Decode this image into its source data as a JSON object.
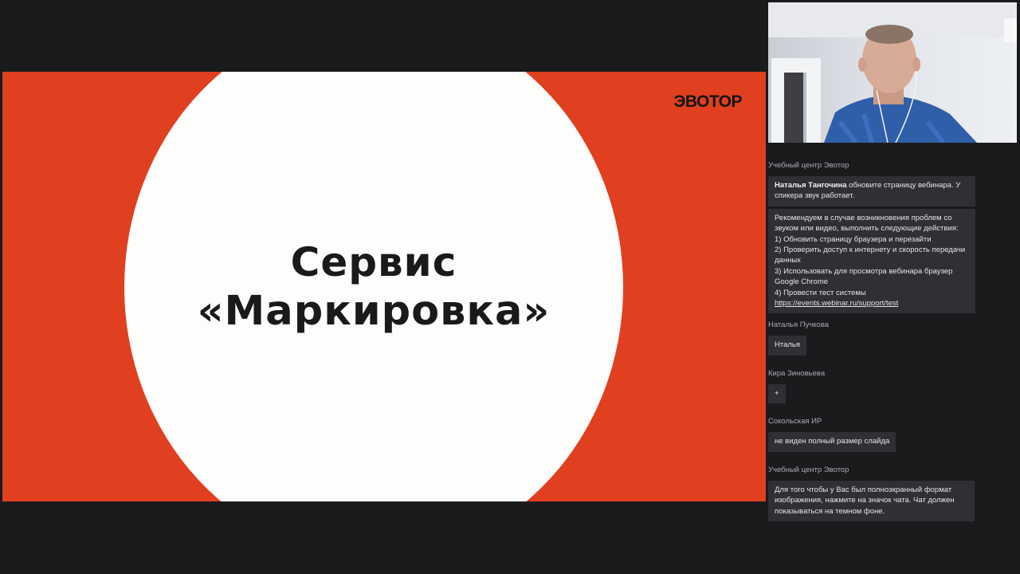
{
  "slide": {
    "logo": "ЭВОТОР",
    "title_line1": "Сервис",
    "title_line2": "«Маркировка»",
    "colors": {
      "background": "#e03f20",
      "circle": "#fdfdfb",
      "text": "#1a1a1a"
    }
  },
  "video": {
    "description_icon": "webcam-feed"
  },
  "chat": {
    "messages": [
      {
        "sender": "Учебный центр Эвотор",
        "mention": "Наталья Тангочина",
        "text": " обновите страницу вебинара. У спикера звук работает."
      },
      {
        "lines": [
          "Рекомендуем в случае возникновения проблем со звуком или видео, выполнить следующие действия:",
          "1) Обновить страницу браузера и перезайти",
          "2) Проверить доступ к интернету и скорость передачи данных",
          "3) Использовать для просмотра вебинара браузер Google Chrome",
          "4) Провести тест системы"
        ],
        "link": "https://events.webinar.ru/support/test"
      },
      {
        "sender": "Наталья Пучкова",
        "text": "Нталья"
      },
      {
        "sender": "Кира Зиновьева",
        "text": "+"
      },
      {
        "sender": "Сокольская ИР",
        "text": "не виден полный размер слайда"
      },
      {
        "sender": "Учебный центр Эвотор",
        "text": "Для того чтобы у Вас был полноэкранный формат изображения, нажмите на значок чата. Чат должен показываться на темном фоне."
      }
    ]
  }
}
